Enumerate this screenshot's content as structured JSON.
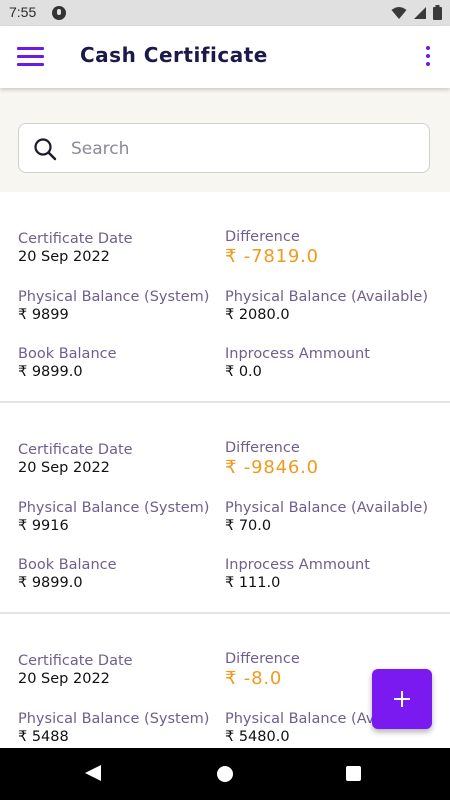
{
  "status_bar": {
    "time": "7:55",
    "icons": [
      "notification-icon",
      "wifi-icon",
      "signal-icon",
      "battery-icon"
    ]
  },
  "app_bar": {
    "title": "Cash Certificate",
    "menu_icon": "hamburger-menu-icon",
    "more_icon": "more-vertical-icon"
  },
  "search": {
    "placeholder": "Search",
    "value": ""
  },
  "labels": {
    "certificate_date": "Certificate Date",
    "difference": "Difference",
    "physical_balance_system": "Physical Balance (System)",
    "physical_balance_available": "Physical Balance (Available)",
    "book_balance": "Book Balance",
    "inprocess_amount": "Inprocess Ammount"
  },
  "records": [
    {
      "certificate_date": "20 Sep 2022",
      "difference": "₹ -7819.0",
      "physical_balance_system": "₹ 9899",
      "physical_balance_available": "₹ 2080.0",
      "book_balance": "₹ 9899.0",
      "inprocess_amount": "₹ 0.0"
    },
    {
      "certificate_date": "20 Sep 2022",
      "difference": "₹ -9846.0",
      "physical_balance_system": "₹ 9916",
      "physical_balance_available": "₹ 70.0",
      "book_balance": "₹ 9899.0",
      "inprocess_amount": "₹ 111.0"
    },
    {
      "certificate_date": "20 Sep 2022",
      "difference": "₹ -8.0",
      "physical_balance_system": "₹ 5488",
      "physical_balance_available": "₹ 5480.0",
      "book_balance": "",
      "inprocess_amount": ""
    }
  ],
  "fab": {
    "icon": "plus-icon"
  },
  "colors": {
    "accent": "#6a1be8",
    "fab": "#7a1af0",
    "difference": "#f29a1c",
    "label": "#6f5f8c",
    "title": "#1b1a4a"
  }
}
